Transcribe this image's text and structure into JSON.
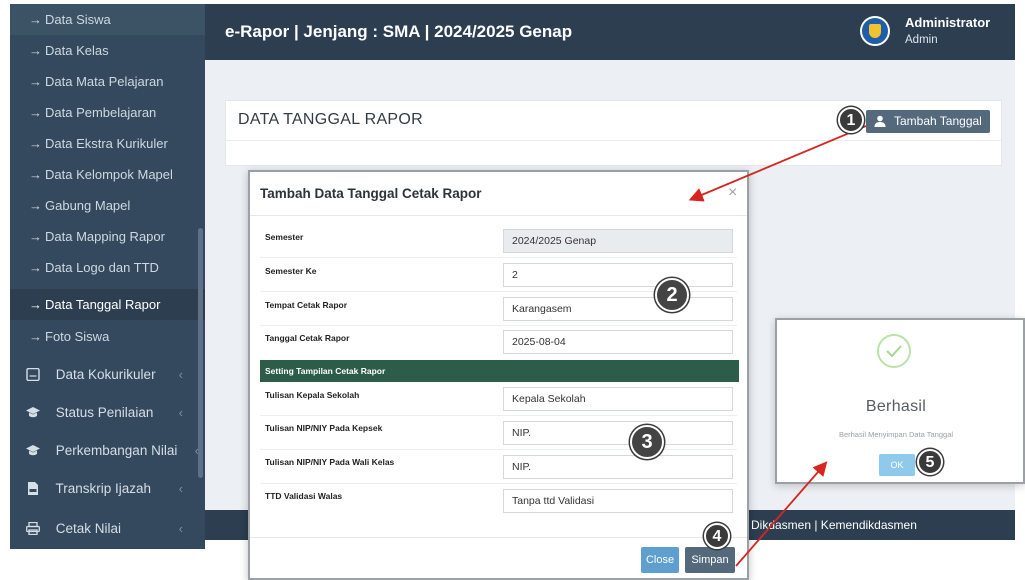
{
  "sidebar": {
    "items": [
      {
        "label": "Data Siswa"
      },
      {
        "label": "Data Kelas"
      },
      {
        "label": "Data Mata Pelajaran"
      },
      {
        "label": "Data Pembelajaran"
      },
      {
        "label": "Data Ekstra Kurikuler"
      },
      {
        "label": "Data Kelompok Mapel"
      },
      {
        "label": "Gabung Mapel"
      },
      {
        "label": "Data Mapping Rapor"
      },
      {
        "label": "Data Logo dan TTD"
      },
      {
        "label": "Data Tanggal Rapor"
      },
      {
        "label": "Foto Siswa"
      }
    ],
    "active_item": "Data Tanggal Rapor",
    "arrow_glyph": "→",
    "caret_glyph": "‹",
    "groups": [
      {
        "label": "Data Kokurikuler",
        "icon": "document-icon"
      },
      {
        "label": "Status Penilaian",
        "icon": "graduation-cap-icon"
      },
      {
        "label": "Perkembangan Nilai",
        "icon": "graduation-cap-icon"
      },
      {
        "label": "Transkrip Ijazah",
        "icon": "pdf-file-icon"
      },
      {
        "label": "Cetak Nilai",
        "icon": "printer-icon"
      }
    ]
  },
  "header": {
    "title": "e-Rapor | Jenjang : SMA | 2024/2025 Genap",
    "user_name": "Administrator",
    "user_role": "Admin"
  },
  "page": {
    "title": "DATA TANGGAL RAPOR",
    "add_button": "Tambah Tanggal"
  },
  "footer": {
    "text": "Dikdasmen | Kemendikdasmen"
  },
  "modal": {
    "title": "Tambah Data Tanggal Cetak Rapor",
    "close_glyph": "×",
    "fields": [
      {
        "label": "Semester",
        "value": "2024/2025 Genap"
      },
      {
        "label": "Semester Ke",
        "value": "2"
      },
      {
        "label": "Tempat Cetak Rapor",
        "value": "Karangasem"
      },
      {
        "label": "Tanggal Cetak Rapor",
        "value": "2025-08-04"
      }
    ],
    "section_title": "Setting Tampilan Cetak Rapor",
    "settings": [
      {
        "label": "Tulisan Kepala Sekolah",
        "value": "Kepala Sekolah"
      },
      {
        "label": "Tulisan NIP/NIY Pada Kepsek",
        "value": "NIP."
      },
      {
        "label": "Tulisan NIP/NIY Pada Wali Kelas",
        "value": "NIP."
      },
      {
        "label": "TTD Validasi Walas",
        "value": "Tanpa ttd Validasi"
      }
    ],
    "close_button": "Close",
    "save_button": "Simpan"
  },
  "success": {
    "title": "Berhasil",
    "message": "Berhasil Menyimpan Data Tanggal",
    "ok_button": "OK"
  },
  "steps": [
    "1",
    "2",
    "3",
    "4",
    "5"
  ],
  "colors": {
    "sidebar_bg": "#34495e",
    "header_bg": "#2c3e50",
    "primary_button": "#54697c",
    "section_bar": "#2e5c4b",
    "annotation_arrow": "#d6261f"
  }
}
